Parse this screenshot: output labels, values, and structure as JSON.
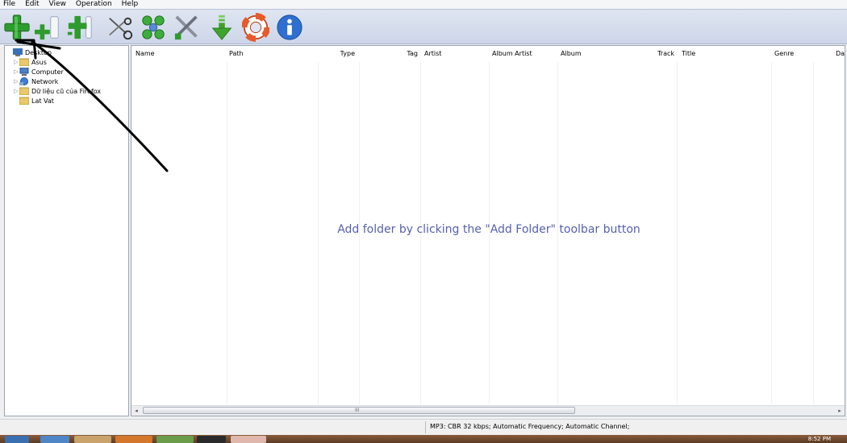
{
  "menu": [
    "File",
    "Edit",
    "View",
    "Operation",
    "Help"
  ],
  "toolbar": [
    {
      "name": "add-folder-button",
      "icon": "green-plus-icon"
    },
    {
      "name": "add-files-button",
      "icon": "small-plus-icon"
    },
    {
      "name": "insert-button",
      "icon": "plus-bracket-icon"
    },
    {
      "name": "cut-button",
      "icon": "scissors-icon"
    },
    {
      "name": "tools-button",
      "icon": "green-circles-icon"
    },
    {
      "name": "options-button",
      "icon": "tools-icon"
    },
    {
      "name": "download-button",
      "icon": "down-arrow-icon"
    },
    {
      "name": "help-button",
      "icon": "lifebuoy-icon"
    },
    {
      "name": "about-button",
      "icon": "info-icon"
    }
  ],
  "tree": [
    {
      "label": "Desktop",
      "icon": "desktop-icon",
      "arrow": ""
    },
    {
      "label": "Asus",
      "icon": "folder-icon",
      "arrow": "▷"
    },
    {
      "label": "Computer",
      "icon": "computer-icon",
      "arrow": "▷"
    },
    {
      "label": "Network",
      "icon": "network-icon",
      "arrow": "▷"
    },
    {
      "label": "Dữ liệu cũ của Firefox",
      "icon": "folder-icon",
      "arrow": "▷"
    },
    {
      "label": "Lat Vat",
      "icon": "folder-icon",
      "arrow": ""
    }
  ],
  "columns": [
    "Name",
    "Path",
    "Type",
    "Tag",
    "Artist",
    "Album Artist",
    "Album",
    "Track",
    "Title",
    "Genre",
    "Da"
  ],
  "hint": "Add folder by clicking the \"Add Folder\" toolbar button",
  "scroll": {
    "left_arrow": "◂",
    "right_arrow": "▸",
    "grip": "III"
  },
  "status": "MP3:  CBR  32 kbps; Automatic Frequency; Automatic Channel;",
  "clock": "8:52 PM",
  "colors": {
    "hint": "#5661b0",
    "accent": "#2e8b2e"
  }
}
